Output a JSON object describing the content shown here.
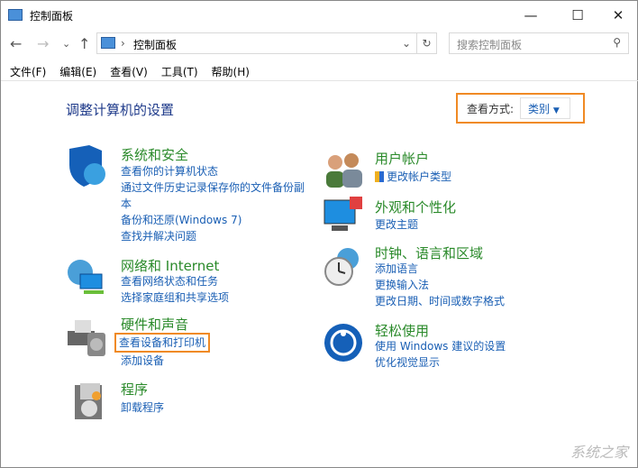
{
  "window": {
    "title": "控制面板",
    "minimize": "—",
    "maximize": "☐",
    "close": "✕"
  },
  "nav": {
    "back": "←",
    "forward": "→",
    "recent": "⌄",
    "up": "↑",
    "address": "控制面板",
    "separator": "›",
    "dropdown": "⌄",
    "refresh": "↻",
    "search_placeholder": "搜索控制面板",
    "search_icon": "⚲"
  },
  "menu": [
    "文件(F)",
    "编辑(E)",
    "查看(V)",
    "工具(T)",
    "帮助(H)"
  ],
  "main": {
    "heading": "调整计算机的设置",
    "view_label": "查看方式:",
    "view_value": "类别",
    "view_arrow": "▼"
  },
  "left": [
    {
      "title": "系统和安全",
      "links": [
        "查看你的计算机状态",
        "通过文件历史记录保存你的文件备份副本",
        "备份和还原(Windows 7)",
        "查找并解决问题"
      ]
    },
    {
      "title": "网络和 Internet",
      "links": [
        "查看网络状态和任务",
        "选择家庭组和共享选项"
      ]
    },
    {
      "title": "硬件和声音",
      "links": [
        "查看设备和打印机",
        "添加设备"
      ]
    },
    {
      "title": "程序",
      "links": [
        "卸载程序"
      ]
    }
  ],
  "right": [
    {
      "title": "用户帐户",
      "links": [
        "更改帐户类型"
      ]
    },
    {
      "title": "外观和个性化",
      "links": [
        "更改主题"
      ]
    },
    {
      "title": "时钟、语言和区域",
      "links": [
        "添加语言",
        "更换输入法",
        "更改日期、时间或数字格式"
      ]
    },
    {
      "title": "轻松使用",
      "links": [
        "使用 Windows 建议的设置",
        "优化视觉显示"
      ]
    }
  ],
  "watermark": "系统之家",
  "colors": {
    "highlight": "#f08a24",
    "link": "#1a5fb4",
    "category": "#2a8a2a"
  }
}
